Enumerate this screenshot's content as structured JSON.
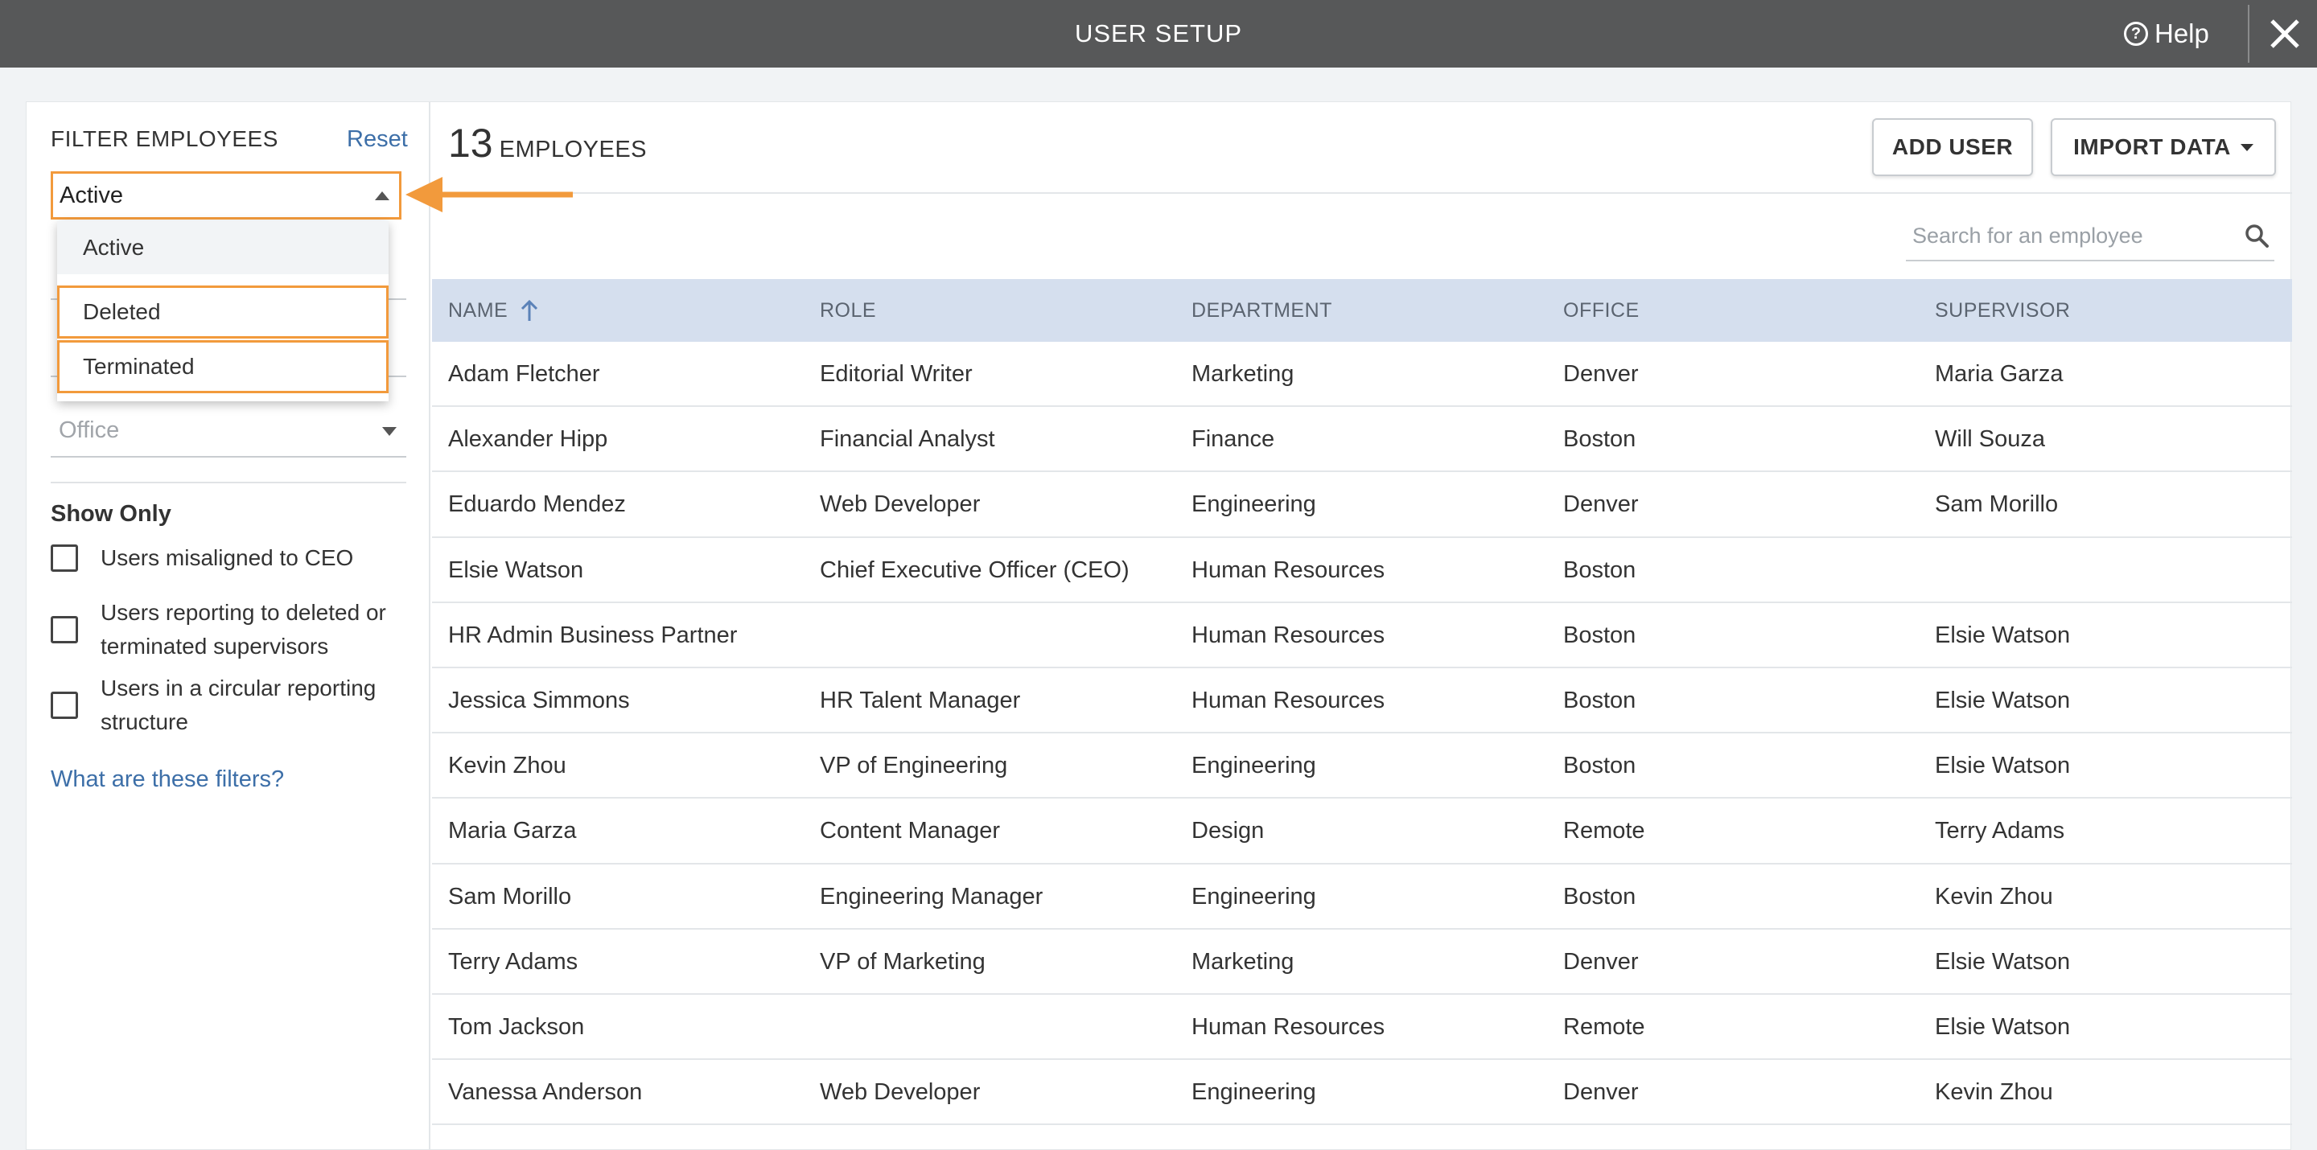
{
  "window": {
    "title": "USER SETUP",
    "help_label": "Help"
  },
  "sidebar": {
    "filter_title": "FILTER EMPLOYEES",
    "reset_label": "Reset",
    "status_select": {
      "value": "Active",
      "options": [
        "Active",
        "Deleted",
        "Terminated"
      ]
    },
    "office_placeholder": "Office",
    "show_only_title": "Show Only",
    "checkboxes": [
      {
        "label": "Users misaligned to CEO",
        "checked": false
      },
      {
        "label": "Users reporting to deleted or terminated supervisors",
        "checked": false
      },
      {
        "label": "Users in a circular reporting structure",
        "checked": false
      }
    ],
    "filters_help_link": "What are these filters?"
  },
  "main": {
    "employee_count": "13",
    "employee_count_label": "EMPLOYEES",
    "add_user_label": "ADD USER",
    "import_data_label": "IMPORT DATA",
    "search_placeholder": "Search for an employee",
    "columns": [
      "NAME",
      "ROLE",
      "DEPARTMENT",
      "OFFICE",
      "SUPERVISOR"
    ],
    "rows": [
      [
        "Adam Fletcher",
        "Editorial Writer",
        "Marketing",
        "Denver",
        "Maria Garza"
      ],
      [
        "Alexander Hipp",
        "Financial Analyst",
        "Finance",
        "Boston",
        "Will Souza"
      ],
      [
        "Eduardo Mendez",
        "Web Developer",
        "Engineering",
        "Denver",
        "Sam Morillo"
      ],
      [
        "Elsie Watson",
        "Chief Executive Officer (CEO)",
        "Human Resources",
        "Boston",
        ""
      ],
      [
        "HR Admin Business Partner",
        "",
        "Human Resources",
        "Boston",
        "Elsie Watson"
      ],
      [
        "Jessica Simmons",
        "HR Talent Manager",
        "Human Resources",
        "Boston",
        "Elsie Watson"
      ],
      [
        "Kevin Zhou",
        "VP of Engineering",
        "Engineering",
        "Boston",
        "Elsie Watson"
      ],
      [
        "Maria Garza",
        "Content Manager",
        "Design",
        "Remote",
        "Terry Adams"
      ],
      [
        "Sam Morillo",
        "Engineering Manager",
        "Engineering",
        "Boston",
        "Kevin Zhou"
      ],
      [
        "Terry Adams",
        "VP of Marketing",
        "Marketing",
        "Denver",
        "Elsie Watson"
      ],
      [
        "Tom Jackson",
        "",
        "Human Resources",
        "Remote",
        "Elsie Watson"
      ],
      [
        "Vanessa Anderson",
        "Web Developer",
        "Engineering",
        "Denver",
        "Kevin Zhou"
      ]
    ]
  },
  "colors": {
    "accent": "#f29a3c",
    "link": "#3d6fa8",
    "header_bg": "#575859",
    "table_head_bg": "#d5dfee"
  },
  "icons": [
    "help-icon",
    "close-icon",
    "search-icon",
    "sort-arrow-up-icon",
    "caret-down-icon",
    "caret-up-icon",
    "annotation-arrow-icon"
  ]
}
